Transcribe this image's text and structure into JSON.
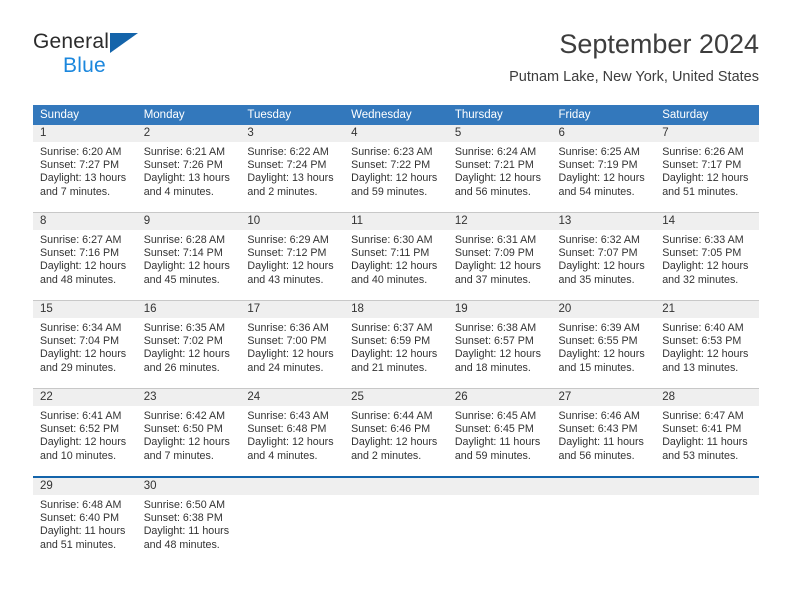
{
  "brand": {
    "name_part1": "General",
    "name_part2": "Blue",
    "accent_color": "#1b87dd",
    "triangle_color": "#1464aa"
  },
  "header": {
    "title": "September 2024",
    "subtitle": "Putnam Lake, New York, United States"
  },
  "calendar": {
    "header_background": "#3378bc",
    "daynumber_background": "#efefef",
    "weekdays": [
      "Sunday",
      "Monday",
      "Tuesday",
      "Wednesday",
      "Thursday",
      "Friday",
      "Saturday"
    ],
    "weeks": [
      [
        {
          "day": "1",
          "sunrise": "Sunrise: 6:20 AM",
          "sunset": "Sunset: 7:27 PM",
          "daylight_line1": "Daylight: 13 hours",
          "daylight_line2": "and 7 minutes."
        },
        {
          "day": "2",
          "sunrise": "Sunrise: 6:21 AM",
          "sunset": "Sunset: 7:26 PM",
          "daylight_line1": "Daylight: 13 hours",
          "daylight_line2": "and 4 minutes."
        },
        {
          "day": "3",
          "sunrise": "Sunrise: 6:22 AM",
          "sunset": "Sunset: 7:24 PM",
          "daylight_line1": "Daylight: 13 hours",
          "daylight_line2": "and 2 minutes."
        },
        {
          "day": "4",
          "sunrise": "Sunrise: 6:23 AM",
          "sunset": "Sunset: 7:22 PM",
          "daylight_line1": "Daylight: 12 hours",
          "daylight_line2": "and 59 minutes."
        },
        {
          "day": "5",
          "sunrise": "Sunrise: 6:24 AM",
          "sunset": "Sunset: 7:21 PM",
          "daylight_line1": "Daylight: 12 hours",
          "daylight_line2": "and 56 minutes."
        },
        {
          "day": "6",
          "sunrise": "Sunrise: 6:25 AM",
          "sunset": "Sunset: 7:19 PM",
          "daylight_line1": "Daylight: 12 hours",
          "daylight_line2": "and 54 minutes."
        },
        {
          "day": "7",
          "sunrise": "Sunrise: 6:26 AM",
          "sunset": "Sunset: 7:17 PM",
          "daylight_line1": "Daylight: 12 hours",
          "daylight_line2": "and 51 minutes."
        }
      ],
      [
        {
          "day": "8",
          "sunrise": "Sunrise: 6:27 AM",
          "sunset": "Sunset: 7:16 PM",
          "daylight_line1": "Daylight: 12 hours",
          "daylight_line2": "and 48 minutes."
        },
        {
          "day": "9",
          "sunrise": "Sunrise: 6:28 AM",
          "sunset": "Sunset: 7:14 PM",
          "daylight_line1": "Daylight: 12 hours",
          "daylight_line2": "and 45 minutes."
        },
        {
          "day": "10",
          "sunrise": "Sunrise: 6:29 AM",
          "sunset": "Sunset: 7:12 PM",
          "daylight_line1": "Daylight: 12 hours",
          "daylight_line2": "and 43 minutes."
        },
        {
          "day": "11",
          "sunrise": "Sunrise: 6:30 AM",
          "sunset": "Sunset: 7:11 PM",
          "daylight_line1": "Daylight: 12 hours",
          "daylight_line2": "and 40 minutes."
        },
        {
          "day": "12",
          "sunrise": "Sunrise: 6:31 AM",
          "sunset": "Sunset: 7:09 PM",
          "daylight_line1": "Daylight: 12 hours",
          "daylight_line2": "and 37 minutes."
        },
        {
          "day": "13",
          "sunrise": "Sunrise: 6:32 AM",
          "sunset": "Sunset: 7:07 PM",
          "daylight_line1": "Daylight: 12 hours",
          "daylight_line2": "and 35 minutes."
        },
        {
          "day": "14",
          "sunrise": "Sunrise: 6:33 AM",
          "sunset": "Sunset: 7:05 PM",
          "daylight_line1": "Daylight: 12 hours",
          "daylight_line2": "and 32 minutes."
        }
      ],
      [
        {
          "day": "15",
          "sunrise": "Sunrise: 6:34 AM",
          "sunset": "Sunset: 7:04 PM",
          "daylight_line1": "Daylight: 12 hours",
          "daylight_line2": "and 29 minutes."
        },
        {
          "day": "16",
          "sunrise": "Sunrise: 6:35 AM",
          "sunset": "Sunset: 7:02 PM",
          "daylight_line1": "Daylight: 12 hours",
          "daylight_line2": "and 26 minutes."
        },
        {
          "day": "17",
          "sunrise": "Sunrise: 6:36 AM",
          "sunset": "Sunset: 7:00 PM",
          "daylight_line1": "Daylight: 12 hours",
          "daylight_line2": "and 24 minutes."
        },
        {
          "day": "18",
          "sunrise": "Sunrise: 6:37 AM",
          "sunset": "Sunset: 6:59 PM",
          "daylight_line1": "Daylight: 12 hours",
          "daylight_line2": "and 21 minutes."
        },
        {
          "day": "19",
          "sunrise": "Sunrise: 6:38 AM",
          "sunset": "Sunset: 6:57 PM",
          "daylight_line1": "Daylight: 12 hours",
          "daylight_line2": "and 18 minutes."
        },
        {
          "day": "20",
          "sunrise": "Sunrise: 6:39 AM",
          "sunset": "Sunset: 6:55 PM",
          "daylight_line1": "Daylight: 12 hours",
          "daylight_line2": "and 15 minutes."
        },
        {
          "day": "21",
          "sunrise": "Sunrise: 6:40 AM",
          "sunset": "Sunset: 6:53 PM",
          "daylight_line1": "Daylight: 12 hours",
          "daylight_line2": "and 13 minutes."
        }
      ],
      [
        {
          "day": "22",
          "sunrise": "Sunrise: 6:41 AM",
          "sunset": "Sunset: 6:52 PM",
          "daylight_line1": "Daylight: 12 hours",
          "daylight_line2": "and 10 minutes."
        },
        {
          "day": "23",
          "sunrise": "Sunrise: 6:42 AM",
          "sunset": "Sunset: 6:50 PM",
          "daylight_line1": "Daylight: 12 hours",
          "daylight_line2": "and 7 minutes."
        },
        {
          "day": "24",
          "sunrise": "Sunrise: 6:43 AM",
          "sunset": "Sunset: 6:48 PM",
          "daylight_line1": "Daylight: 12 hours",
          "daylight_line2": "and 4 minutes."
        },
        {
          "day": "25",
          "sunrise": "Sunrise: 6:44 AM",
          "sunset": "Sunset: 6:46 PM",
          "daylight_line1": "Daylight: 12 hours",
          "daylight_line2": "and 2 minutes."
        },
        {
          "day": "26",
          "sunrise": "Sunrise: 6:45 AM",
          "sunset": "Sunset: 6:45 PM",
          "daylight_line1": "Daylight: 11 hours",
          "daylight_line2": "and 59 minutes."
        },
        {
          "day": "27",
          "sunrise": "Sunrise: 6:46 AM",
          "sunset": "Sunset: 6:43 PM",
          "daylight_line1": "Daylight: 11 hours",
          "daylight_line2": "and 56 minutes."
        },
        {
          "day": "28",
          "sunrise": "Sunrise: 6:47 AM",
          "sunset": "Sunset: 6:41 PM",
          "daylight_line1": "Daylight: 11 hours",
          "daylight_line2": "and 53 minutes."
        }
      ],
      [
        {
          "day": "29",
          "sunrise": "Sunrise: 6:48 AM",
          "sunset": "Sunset: 6:40 PM",
          "daylight_line1": "Daylight: 11 hours",
          "daylight_line2": "and 51 minutes."
        },
        {
          "day": "30",
          "sunrise": "Sunrise: 6:50 AM",
          "sunset": "Sunset: 6:38 PM",
          "daylight_line1": "Daylight: 11 hours",
          "daylight_line2": "and 48 minutes."
        },
        {
          "day": "",
          "sunrise": "",
          "sunset": "",
          "daylight_line1": "",
          "daylight_line2": ""
        },
        {
          "day": "",
          "sunrise": "",
          "sunset": "",
          "daylight_line1": "",
          "daylight_line2": ""
        },
        {
          "day": "",
          "sunrise": "",
          "sunset": "",
          "daylight_line1": "",
          "daylight_line2": ""
        },
        {
          "day": "",
          "sunrise": "",
          "sunset": "",
          "daylight_line1": "",
          "daylight_line2": ""
        },
        {
          "day": "",
          "sunrise": "",
          "sunset": "",
          "daylight_line1": "",
          "daylight_line2": ""
        }
      ]
    ]
  }
}
